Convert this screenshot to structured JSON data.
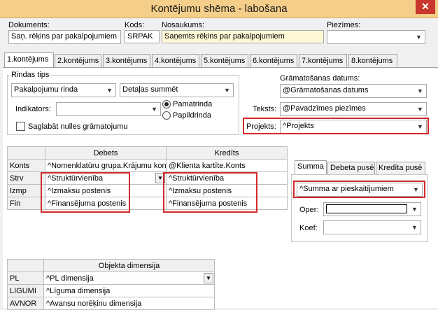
{
  "window": {
    "title": "Kontējumu shēma - labošana",
    "close_label": "✕"
  },
  "header": {
    "dokuments": {
      "label": "Dokuments:",
      "value": "Saņ. rēķins par pakalpojumiem"
    },
    "kods": {
      "label": "Kods:",
      "value": "SRPAK"
    },
    "nosaukums": {
      "label": "Nosaukums:",
      "value": "Saņemts rēķins par pakalpojumiem"
    },
    "piezimes": {
      "label": "Piezīmes:",
      "value": ""
    }
  },
  "tabs": [
    "1.kontējums",
    "2.kontējums",
    "3.kontējums",
    "4.kontējums",
    "5.kontējums",
    "6.kontējums",
    "7.kontējums",
    "8.kontējums"
  ],
  "rindas_tips": {
    "label": "Rindas tips",
    "type_value": "Pakalpojumu rinda",
    "sum_value": "Detaļas summēt",
    "indikators_label": "Indikators:",
    "indikators_value": "",
    "radio_pamatrinda": "Pamatrinda",
    "radio_papildrinda": "Papildrinda",
    "checkbox_label": "Saglabāt nulles grāmatojumu"
  },
  "right_fields": {
    "gram_datums_label": "Grāmatošanas datums:",
    "gram_datums_value": "@Grāmatošanas datums",
    "teksts_label": "Teksts:",
    "teksts_value": "@Pavadzīmes piezīmes",
    "projekts_label": "Projekts:",
    "projekts_value": "^Projekts"
  },
  "acct_grid": {
    "debets_header": "Debets",
    "kredits_header": "Kredīts",
    "rows": [
      {
        "name": "Konts",
        "debets": "^Nomenklatūru grupa.Krājumu konts",
        "kredits": "@Klienta kartīte.Konts"
      },
      {
        "name": "Strv",
        "debets": "^Struktūrvienība",
        "kredits": "^Struktūrvienība"
      },
      {
        "name": "Izmp",
        "debets": "^Izmaksu postenis",
        "kredits": "^Izmaksu postenis"
      },
      {
        "name": "Fin",
        "debets": "^Finansējuma postenis",
        "kredits": "^Finansējuma postenis"
      }
    ]
  },
  "summa_tabs": [
    "Summa",
    "Debeta pusē",
    "Kredīta pusē"
  ],
  "summa": {
    "value": "^Summa ar pieskaitījumiem",
    "oper_label": "Oper:",
    "oper_value": "",
    "koef_label": "Koef:",
    "koef_value": ""
  },
  "dim_grid": {
    "header": "Objekta dimensija",
    "rows": [
      {
        "name": "PL",
        "value": "^PL dimensija"
      },
      {
        "name": "LIGUMI",
        "value": "^Līguma dimensija"
      },
      {
        "name": "AVNOR",
        "value": "^Avansu norēķinu dimensija"
      }
    ]
  }
}
